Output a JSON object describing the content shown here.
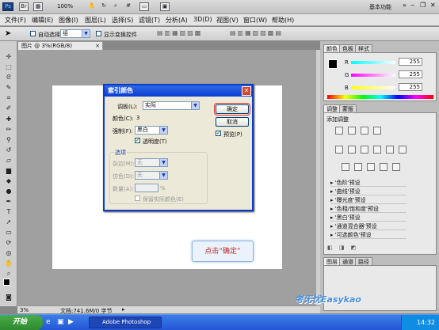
{
  "appbar": {
    "ps_logo": "Ps",
    "zoom": "100%",
    "workspace": "基本功能"
  },
  "menu": [
    "文件(F)",
    "编辑(E)",
    "图像(I)",
    "图层(L)",
    "选择(S)",
    "滤镜(T)",
    "分析(A)",
    "3D(D)",
    "视图(V)",
    "窗口(W)",
    "帮助(H)"
  ],
  "options": {
    "auto_select_label": "自动选择:",
    "auto_select_value": "组",
    "transform_label": "显示变换控件"
  },
  "document": {
    "tab": "图片 @ 3%(RGB/8)",
    "zoom": "3%",
    "doc_info": "文档:741.6M/0 字节"
  },
  "color_panel": {
    "tabs": [
      "颜色",
      "色板",
      "样式"
    ],
    "labels": [
      "R",
      "G",
      "B"
    ],
    "values": [
      "255",
      "255",
      "255"
    ],
    "accent": "#00a8e8"
  },
  "adjust_panel": {
    "tabs": [
      "调整",
      "蒙版"
    ],
    "title": "添加调整",
    "presets": [
      "'色阶'预设",
      "'曲线'预设",
      "'曝光度'预设",
      "'色相/饱和度'预设",
      "'黑白'预设",
      "'通道混合器'预设",
      "'可选颜色'预设"
    ]
  },
  "layers_panel": {
    "tabs": [
      "图层",
      "通道",
      "路径"
    ]
  },
  "dialog": {
    "title": "索引颜色",
    "palette_label": "调板(L):",
    "palette_value": "实际",
    "colors_label": "颜色(C):",
    "colors_value": "3",
    "forced_label": "强制(F):",
    "forced_value": "黑白",
    "transparency_label": "透明度(T)",
    "options_group": "选项",
    "matte_label": "杂边(M):",
    "matte_value": "无",
    "dither_label": "仿色(D):",
    "dither_value": "无",
    "amount_label": "数量(A):",
    "amount_unit": "%",
    "preserve_label": "保留实际颜色(E)",
    "ok": "确定",
    "cancel": "取消",
    "preview": "预览(P)"
  },
  "callout": "点击“确定”",
  "taskbar": {
    "start": "开始",
    "task": "Adobe Photoshop",
    "time": "14:32"
  },
  "watermark": "考无忧Easykao"
}
